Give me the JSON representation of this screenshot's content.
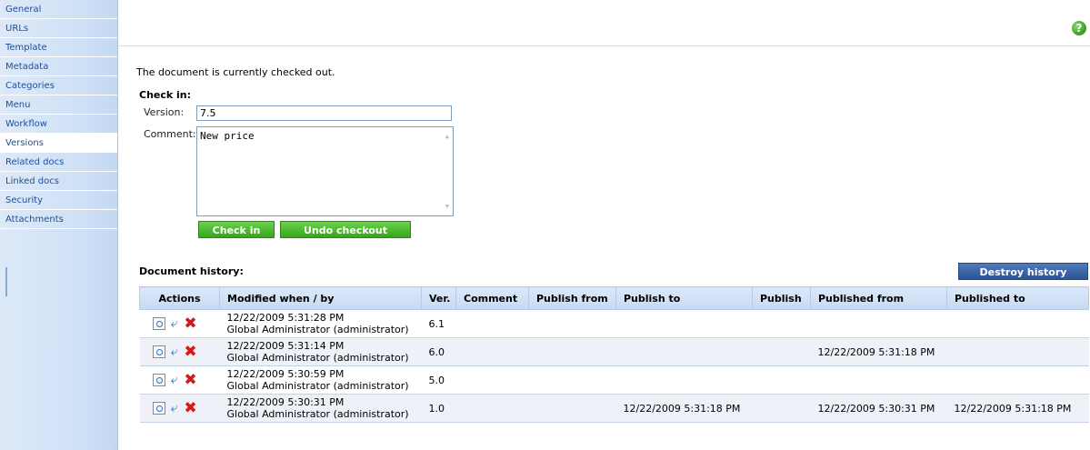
{
  "sidebar": {
    "items": [
      {
        "label": "General"
      },
      {
        "label": "URLs"
      },
      {
        "label": "Template"
      },
      {
        "label": "Metadata"
      },
      {
        "label": "Categories"
      },
      {
        "label": "Menu"
      },
      {
        "label": "Workflow"
      },
      {
        "label": "Versions",
        "active": true
      },
      {
        "label": "Related docs"
      },
      {
        "label": "Linked docs"
      },
      {
        "label": "Security"
      },
      {
        "label": "Attachments"
      }
    ]
  },
  "header": {
    "help_icon": "help-icon",
    "help_glyph": "?"
  },
  "status_text": "The document is currently checked out.",
  "checkin": {
    "title": "Check in:",
    "version_label": "Version:",
    "version_value": "7.5",
    "comment_label": "Comment:",
    "comment_value": "New price",
    "checkin_button": "Check in",
    "undo_button": "Undo checkout"
  },
  "history": {
    "title": "Document history:",
    "destroy_button": "Destroy history",
    "columns": [
      "Actions",
      "Modified when / by",
      "Ver.",
      "Comment",
      "Publish from",
      "Publish to",
      "Publish",
      "Published from",
      "Published to"
    ],
    "rows": [
      {
        "modified_when": "12/22/2009 5:31:28 PM",
        "modified_by": "Global Administrator (administrator)",
        "ver": "6.1",
        "comment": "",
        "publish_from": "",
        "publish_to": "",
        "publish": "",
        "published_from": "",
        "published_to": ""
      },
      {
        "modified_when": "12/22/2009 5:31:14 PM",
        "modified_by": "Global Administrator (administrator)",
        "ver": "6.0",
        "comment": "",
        "publish_from": "",
        "publish_to": "",
        "publish": "",
        "published_from": "12/22/2009 5:31:18 PM",
        "published_to": ""
      },
      {
        "modified_when": "12/22/2009 5:30:59 PM",
        "modified_by": "Global Administrator (administrator)",
        "ver": "5.0",
        "comment": "",
        "publish_from": "",
        "publish_to": "",
        "publish": "",
        "published_from": "",
        "published_to": ""
      },
      {
        "modified_when": "12/22/2009 5:30:31 PM",
        "modified_by": "Global Administrator (administrator)",
        "ver": "1.0",
        "comment": "",
        "publish_from": "",
        "publish_to": "12/22/2009 5:31:18 PM",
        "publish": "",
        "published_from": "12/22/2009 5:30:31 PM",
        "published_to": "12/22/2009 5:31:18 PM"
      }
    ],
    "row_action_icons": [
      "view-icon",
      "rollback-icon",
      "delete-icon"
    ]
  },
  "colors": {
    "sidebar_bg": "#cfe0f6",
    "link": "#1b4f9c",
    "green_button": "#37a51b",
    "blue_button": "#2a5596",
    "table_header": "#c7daf3",
    "alt_row": "#eef1f7"
  }
}
